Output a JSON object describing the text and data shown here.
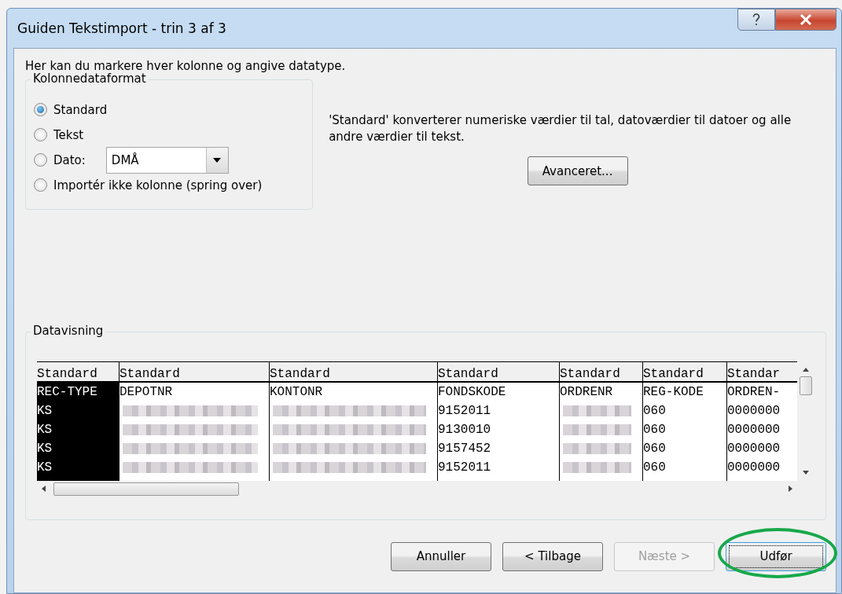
{
  "window": {
    "title": "Guiden Tekstimport - trin 3 af 3"
  },
  "intro": "Her kan du markere hver kolonne og angive datatype.",
  "format_group": {
    "title": "Kolonnedataformat",
    "options": [
      {
        "label": "Standard",
        "selected": true,
        "kind": "plain"
      },
      {
        "label": "Tekst",
        "selected": false,
        "kind": "plain"
      },
      {
        "label": "Dato:",
        "selected": false,
        "kind": "date"
      },
      {
        "label": "Importér ikke kolonne (spring over)",
        "selected": false,
        "kind": "plain"
      }
    ],
    "date_format": "DMÅ"
  },
  "description": "'Standard' konverterer numeriske værdier til tal, datoværdier til datoer og alle andre værdier til tekst.",
  "advanced_button": "Avanceret...",
  "preview": {
    "title": "Datavisning",
    "columns": [
      {
        "header": "Standard",
        "selected": true,
        "cells": [
          {
            "text": "REC-TYPE",
            "kind": "text"
          },
          {
            "text": "KS",
            "kind": "text"
          },
          {
            "text": "KS",
            "kind": "text"
          },
          {
            "text": "KS",
            "kind": "text"
          },
          {
            "text": "KS",
            "kind": "text"
          }
        ]
      },
      {
        "header": "Standard",
        "selected": false,
        "cells": [
          {
            "text": "DEPOTNR",
            "kind": "text"
          },
          {
            "kind": "blurred"
          },
          {
            "kind": "blurred"
          },
          {
            "kind": "blurred"
          },
          {
            "kind": "blurred"
          }
        ]
      },
      {
        "header": "Standard",
        "selected": false,
        "cells": [
          {
            "text": "KONTONR",
            "kind": "text"
          },
          {
            "kind": "blurred"
          },
          {
            "kind": "blurred"
          },
          {
            "kind": "blurred"
          },
          {
            "kind": "blurred"
          }
        ]
      },
      {
        "header": "Standard",
        "selected": false,
        "cells": [
          {
            "text": "FONDSKODE",
            "kind": "text"
          },
          {
            "text": "9152011",
            "kind": "text"
          },
          {
            "text": "9130010",
            "kind": "text"
          },
          {
            "text": "9157452",
            "kind": "text"
          },
          {
            "text": "9152011",
            "kind": "text"
          }
        ]
      },
      {
        "header": "Standard",
        "selected": false,
        "cells": [
          {
            "text": "ORDRENR",
            "kind": "text"
          },
          {
            "kind": "blurred"
          },
          {
            "kind": "blurred"
          },
          {
            "kind": "blurred"
          },
          {
            "kind": "blurred"
          }
        ]
      },
      {
        "header": "Standard",
        "selected": false,
        "cells": [
          {
            "text": "REG-KODE",
            "kind": "text"
          },
          {
            "text": "060",
            "kind": "text"
          },
          {
            "text": "060",
            "kind": "text"
          },
          {
            "text": "060",
            "kind": "text"
          },
          {
            "text": "060",
            "kind": "text"
          }
        ]
      },
      {
        "header": "Standar",
        "selected": false,
        "cells": [
          {
            "text": "ORDREN-",
            "kind": "text"
          },
          {
            "text": "0000000",
            "kind": "text"
          },
          {
            "text": "0000000",
            "kind": "text"
          },
          {
            "text": "0000000",
            "kind": "text"
          },
          {
            "text": "0000000",
            "kind": "text"
          }
        ]
      }
    ]
  },
  "buttons": [
    {
      "label": "Annuller",
      "disabled": false,
      "default": false
    },
    {
      "label": "< Tilbage",
      "disabled": false,
      "default": false
    },
    {
      "label": "Næste >",
      "disabled": true,
      "default": false
    },
    {
      "label": "Udfør",
      "disabled": false,
      "default": true
    }
  ]
}
